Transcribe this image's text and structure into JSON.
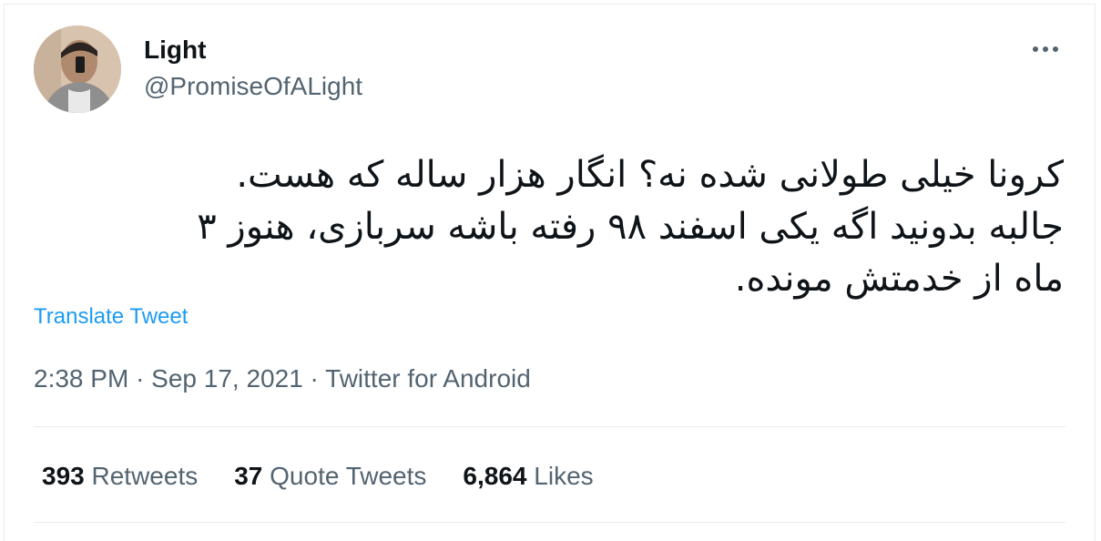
{
  "author": {
    "display_name": "Light",
    "handle": "@PromiseOfALight",
    "avatar_icon": "user-avatar-photo"
  },
  "more_icon": "more-dots-icon",
  "tweet": {
    "text": "کرونا خیلی طولانی شده نه؟ انگار هزار ساله که هست.\nجالبه بدونید اگه یکی اسفند ۹۸ رفته باشه سربازی، هنوز ۳\nماه از خدمتش مونده."
  },
  "translate_label": "Translate Tweet",
  "meta": {
    "time": "2:38 PM",
    "separator": "·",
    "date": "Sep 17, 2021",
    "source": "Twitter for Android"
  },
  "stats": {
    "retweets": {
      "count": "393",
      "label": "Retweets"
    },
    "quote_tweets": {
      "count": "37",
      "label": "Quote Tweets"
    },
    "likes": {
      "count": "6,864",
      "label": "Likes"
    }
  },
  "colors": {
    "text_primary": "#0f1419",
    "text_secondary": "#536471",
    "link_blue": "#1d9bf0",
    "border": "#e7ecf0"
  }
}
